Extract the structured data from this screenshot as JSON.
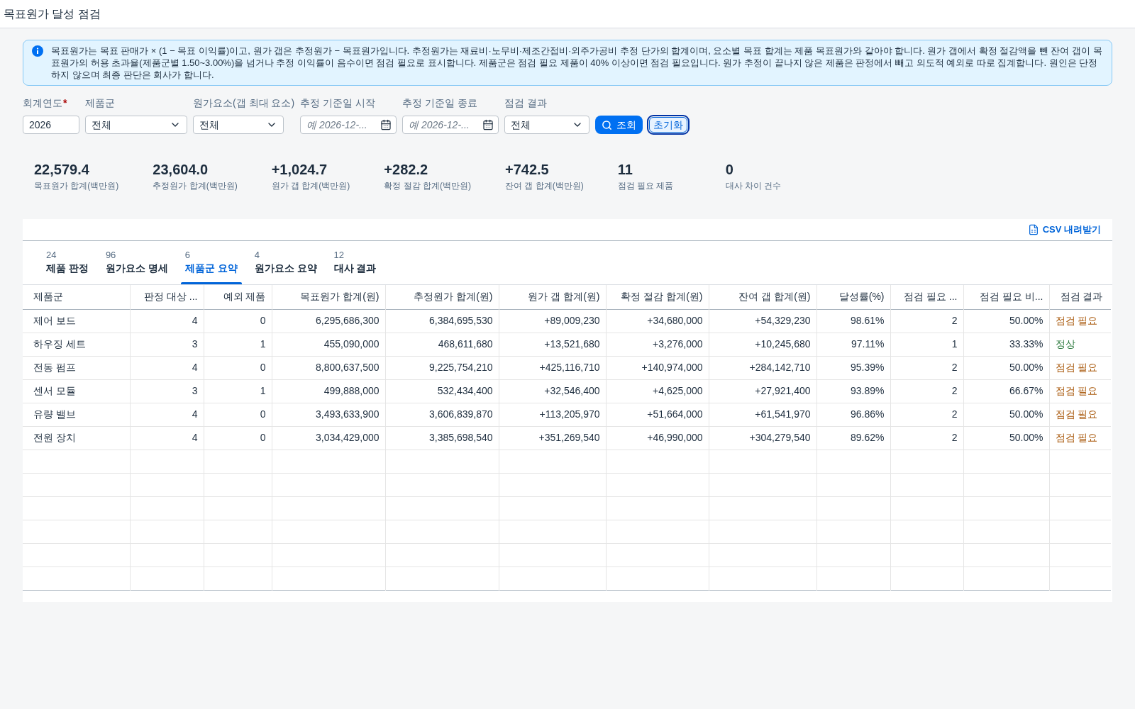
{
  "page": {
    "title": "목표원가 달성 점검"
  },
  "notice": {
    "text": "목표원가는 목표 판매가 × (1 − 목표 이익률)이고, 원가 갭은 추정원가 − 목표원가입니다. 추정원가는 재료비·노무비·제조간접비·외주가공비 추정 단가의 합계이며, 요소별 목표 합계는 제품 목표원가와 같아야 합니다. 원가 갭에서 확정 절감액을 뺀 잔여 갭이 목표원가의 허용 초과율(제품군별 1.50~3.00%)을 넘거나 추정 이익률이 음수이면 점검 필요로 표시합니다. 제품군은 점검 필요 제품이 40% 이상이면 점검 필요입니다. 원가 추정이 끝나지 않은 제품은 판정에서 빼고 의도적 예외로 따로 집계합니다. 원인은 단정하지 않으며 최종 판단은 회사가 합니다."
  },
  "filters": [
    {
      "kind": "text",
      "label": "회계연도",
      "required_mark": "*",
      "value": "2026"
    },
    {
      "kind": "select",
      "label": "제품군",
      "value": "전체"
    },
    {
      "kind": "select",
      "label": "원가요소(갭 최대 요소)",
      "value": "전체"
    },
    {
      "kind": "date",
      "label": "추정 기준일 시작",
      "placeholder": "예 2026-12-..."
    },
    {
      "kind": "date",
      "label": "추정 기준일 종료",
      "placeholder": "예 2026-12-..."
    },
    {
      "kind": "select",
      "label": "점검 결과",
      "value": "전체"
    }
  ],
  "actions": [
    {
      "kind": "primary",
      "label": "조회",
      "focused": false
    },
    {
      "kind": "secondary",
      "label": "초기화",
      "focused": true
    }
  ],
  "kpis": [
    {
      "value": "22,579.4",
      "label": "목표원가 합계(백만원)"
    },
    {
      "value": "23,604.0",
      "label": "추정원가 합계(백만원)"
    },
    {
      "value": "+1,024.7",
      "label": "원가 갭 합계(백만원)"
    },
    {
      "value": "+282.2",
      "label": "확정 절감 합계(백만원)"
    },
    {
      "value": "+742.5",
      "label": "잔여 갭 합계(백만원)"
    },
    {
      "value": "11",
      "label": "점검 필요 제품"
    },
    {
      "value": "0",
      "label": "대사 차이 건수"
    }
  ],
  "panel": {
    "export_button": "CSV 내려받기",
    "tabs": [
      {
        "count": "24",
        "label": "제품 판정",
        "selected": false
      },
      {
        "count": "96",
        "label": "원가요소 명세",
        "selected": false
      },
      {
        "count": "6",
        "label": "제품군 요약",
        "selected": true
      },
      {
        "count": "4",
        "label": "원가요소 요약",
        "selected": false
      },
      {
        "count": "12",
        "label": "대사 결과",
        "selected": false
      }
    ],
    "table": {
      "columns": [
        "제품군",
        "판정 대상 ...",
        "예외 제품",
        "목표원가 합계(원)",
        "추정원가 합계(원)",
        "원가 갭 합계(원)",
        "확정 절감 합계(원)",
        "잔여 갭 합계(원)",
        "달성률(%)",
        "점검 필요 ...",
        "점검 필요 비...",
        "점검 결과"
      ],
      "rows": [
        {
          "cells": [
            "제어 보드",
            "4",
            "0",
            "6,295,686,300",
            "6,384,695,530",
            "+89,009,230",
            "+34,680,000",
            "+54,329,230",
            "98.61%",
            "2",
            "50.00%"
          ],
          "result": {
            "text": "점검 필요",
            "color": "#a9590c"
          }
        },
        {
          "cells": [
            "하우징 세트",
            "3",
            "1",
            "455,090,000",
            "468,611,680",
            "+13,521,680",
            "+3,276,000",
            "+10,245,680",
            "97.11%",
            "1",
            "33.33%"
          ],
          "result": {
            "text": "정상",
            "color": "#2b7a3d"
          }
        },
        {
          "cells": [
            "전동 펌프",
            "4",
            "0",
            "8,800,637,500",
            "9,225,754,210",
            "+425,116,710",
            "+140,974,000",
            "+284,142,710",
            "95.39%",
            "2",
            "50.00%"
          ],
          "result": {
            "text": "점검 필요",
            "color": "#a9590c"
          }
        },
        {
          "cells": [
            "센서 모듈",
            "3",
            "1",
            "499,888,000",
            "532,434,400",
            "+32,546,400",
            "+4,625,000",
            "+27,921,400",
            "93.89%",
            "2",
            "66.67%"
          ],
          "result": {
            "text": "점검 필요",
            "color": "#a9590c"
          }
        },
        {
          "cells": [
            "유량 밸브",
            "4",
            "0",
            "3,493,633,900",
            "3,606,839,870",
            "+113,205,970",
            "+51,664,000",
            "+61,541,970",
            "96.86%",
            "2",
            "50.00%"
          ],
          "result": {
            "text": "점검 필요",
            "color": "#a9590c"
          }
        },
        {
          "cells": [
            "전원 장치",
            "4",
            "0",
            "3,034,429,000",
            "3,385,698,540",
            "+351,269,540",
            "+46,990,000",
            "+304,279,540",
            "89.62%",
            "2",
            "50.00%"
          ],
          "result": {
            "text": "점검 필요",
            "color": "#a9590c"
          }
        }
      ]
    }
  }
}
